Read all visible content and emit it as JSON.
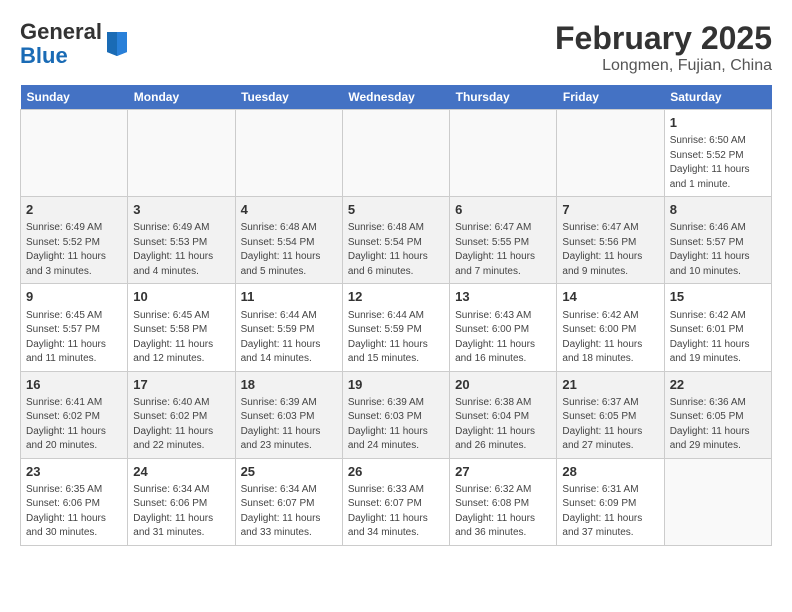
{
  "header": {
    "logo_general": "General",
    "logo_blue": "Blue",
    "title": "February 2025",
    "location": "Longmen, Fujian, China"
  },
  "days_of_week": [
    "Sunday",
    "Monday",
    "Tuesday",
    "Wednesday",
    "Thursday",
    "Friday",
    "Saturday"
  ],
  "weeks": [
    [
      {
        "day": "",
        "info": ""
      },
      {
        "day": "",
        "info": ""
      },
      {
        "day": "",
        "info": ""
      },
      {
        "day": "",
        "info": ""
      },
      {
        "day": "",
        "info": ""
      },
      {
        "day": "",
        "info": ""
      },
      {
        "day": "1",
        "info": "Sunrise: 6:50 AM\nSunset: 5:52 PM\nDaylight: 11 hours\nand 1 minute."
      }
    ],
    [
      {
        "day": "2",
        "info": "Sunrise: 6:49 AM\nSunset: 5:52 PM\nDaylight: 11 hours\nand 3 minutes."
      },
      {
        "day": "3",
        "info": "Sunrise: 6:49 AM\nSunset: 5:53 PM\nDaylight: 11 hours\nand 4 minutes."
      },
      {
        "day": "4",
        "info": "Sunrise: 6:48 AM\nSunset: 5:54 PM\nDaylight: 11 hours\nand 5 minutes."
      },
      {
        "day": "5",
        "info": "Sunrise: 6:48 AM\nSunset: 5:54 PM\nDaylight: 11 hours\nand 6 minutes."
      },
      {
        "day": "6",
        "info": "Sunrise: 6:47 AM\nSunset: 5:55 PM\nDaylight: 11 hours\nand 7 minutes."
      },
      {
        "day": "7",
        "info": "Sunrise: 6:47 AM\nSunset: 5:56 PM\nDaylight: 11 hours\nand 9 minutes."
      },
      {
        "day": "8",
        "info": "Sunrise: 6:46 AM\nSunset: 5:57 PM\nDaylight: 11 hours\nand 10 minutes."
      }
    ],
    [
      {
        "day": "9",
        "info": "Sunrise: 6:45 AM\nSunset: 5:57 PM\nDaylight: 11 hours\nand 11 minutes."
      },
      {
        "day": "10",
        "info": "Sunrise: 6:45 AM\nSunset: 5:58 PM\nDaylight: 11 hours\nand 12 minutes."
      },
      {
        "day": "11",
        "info": "Sunrise: 6:44 AM\nSunset: 5:59 PM\nDaylight: 11 hours\nand 14 minutes."
      },
      {
        "day": "12",
        "info": "Sunrise: 6:44 AM\nSunset: 5:59 PM\nDaylight: 11 hours\nand 15 minutes."
      },
      {
        "day": "13",
        "info": "Sunrise: 6:43 AM\nSunset: 6:00 PM\nDaylight: 11 hours\nand 16 minutes."
      },
      {
        "day": "14",
        "info": "Sunrise: 6:42 AM\nSunset: 6:00 PM\nDaylight: 11 hours\nand 18 minutes."
      },
      {
        "day": "15",
        "info": "Sunrise: 6:42 AM\nSunset: 6:01 PM\nDaylight: 11 hours\nand 19 minutes."
      }
    ],
    [
      {
        "day": "16",
        "info": "Sunrise: 6:41 AM\nSunset: 6:02 PM\nDaylight: 11 hours\nand 20 minutes."
      },
      {
        "day": "17",
        "info": "Sunrise: 6:40 AM\nSunset: 6:02 PM\nDaylight: 11 hours\nand 22 minutes."
      },
      {
        "day": "18",
        "info": "Sunrise: 6:39 AM\nSunset: 6:03 PM\nDaylight: 11 hours\nand 23 minutes."
      },
      {
        "day": "19",
        "info": "Sunrise: 6:39 AM\nSunset: 6:03 PM\nDaylight: 11 hours\nand 24 minutes."
      },
      {
        "day": "20",
        "info": "Sunrise: 6:38 AM\nSunset: 6:04 PM\nDaylight: 11 hours\nand 26 minutes."
      },
      {
        "day": "21",
        "info": "Sunrise: 6:37 AM\nSunset: 6:05 PM\nDaylight: 11 hours\nand 27 minutes."
      },
      {
        "day": "22",
        "info": "Sunrise: 6:36 AM\nSunset: 6:05 PM\nDaylight: 11 hours\nand 29 minutes."
      }
    ],
    [
      {
        "day": "23",
        "info": "Sunrise: 6:35 AM\nSunset: 6:06 PM\nDaylight: 11 hours\nand 30 minutes."
      },
      {
        "day": "24",
        "info": "Sunrise: 6:34 AM\nSunset: 6:06 PM\nDaylight: 11 hours\nand 31 minutes."
      },
      {
        "day": "25",
        "info": "Sunrise: 6:34 AM\nSunset: 6:07 PM\nDaylight: 11 hours\nand 33 minutes."
      },
      {
        "day": "26",
        "info": "Sunrise: 6:33 AM\nSunset: 6:07 PM\nDaylight: 11 hours\nand 34 minutes."
      },
      {
        "day": "27",
        "info": "Sunrise: 6:32 AM\nSunset: 6:08 PM\nDaylight: 11 hours\nand 36 minutes."
      },
      {
        "day": "28",
        "info": "Sunrise: 6:31 AM\nSunset: 6:09 PM\nDaylight: 11 hours\nand 37 minutes."
      },
      {
        "day": "",
        "info": ""
      }
    ]
  ]
}
